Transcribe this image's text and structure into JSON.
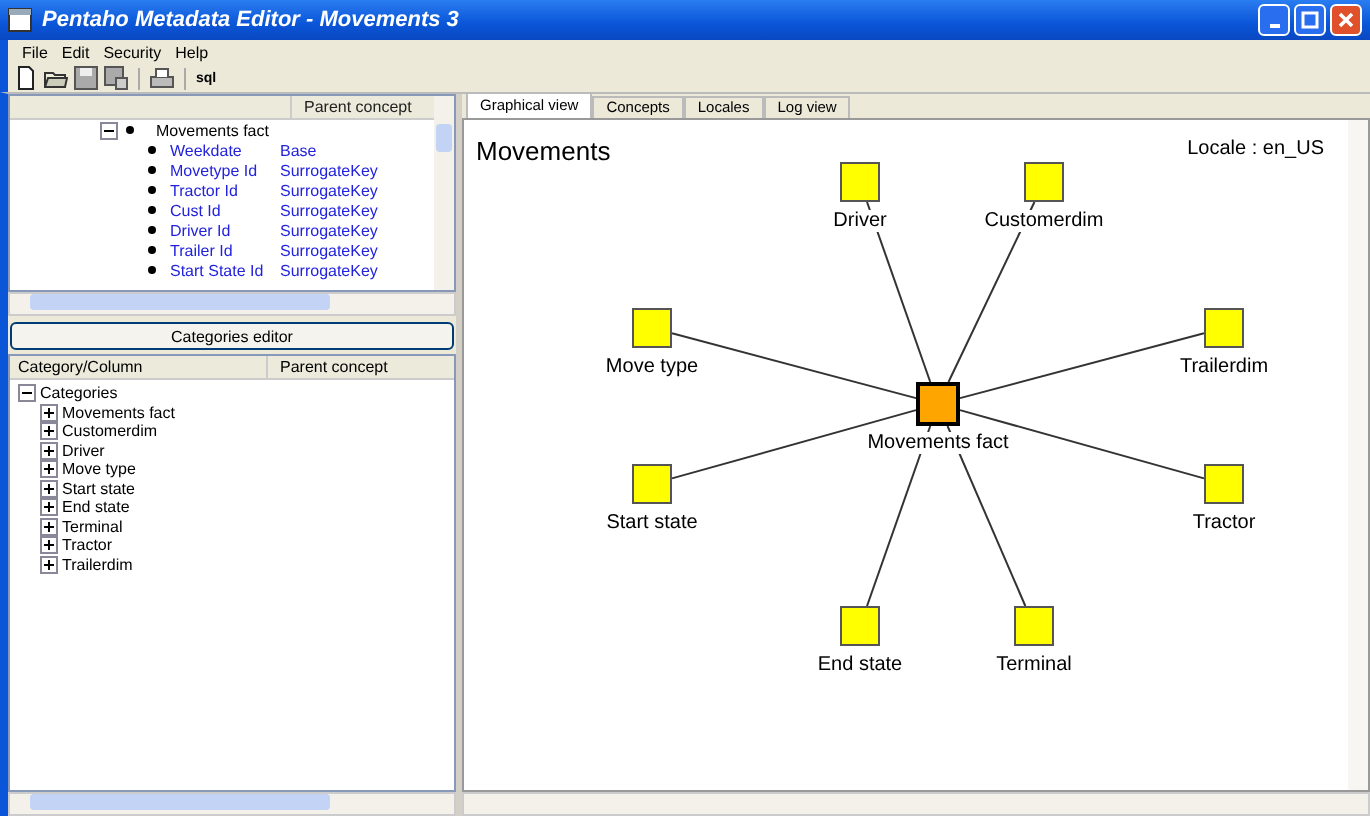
{
  "window": {
    "title": "Pentaho Metadata Editor - Movements 3"
  },
  "menu": [
    "File",
    "Edit",
    "Security",
    "Help"
  ],
  "toolbar": {
    "sql_label": "sql"
  },
  "model_tree": {
    "column": "Parent concept",
    "parent": {
      "label": "Movements fact",
      "expanded": true
    },
    "rows": [
      {
        "name": "Weekdate",
        "parent_concept": "Base"
      },
      {
        "name": "Movetype Id",
        "parent_concept": "SurrogateKey"
      },
      {
        "name": "Tractor Id",
        "parent_concept": "SurrogateKey"
      },
      {
        "name": "Cust Id",
        "parent_concept": "SurrogateKey"
      },
      {
        "name": "Driver Id",
        "parent_concept": "SurrogateKey"
      },
      {
        "name": "Trailer Id",
        "parent_concept": "SurrogateKey"
      },
      {
        "name": "Start State Id",
        "parent_concept": "SurrogateKey"
      }
    ]
  },
  "categories_button": "Categories editor",
  "categories_tree": {
    "columns": [
      "Category/Column",
      "Parent concept"
    ],
    "root": {
      "label": "Categories",
      "expanded": true
    },
    "children": [
      {
        "label": "Movements fact",
        "expanded": false
      },
      {
        "label": "Customerdim",
        "expanded": false
      },
      {
        "label": "Driver",
        "expanded": false
      },
      {
        "label": "Move type",
        "expanded": false
      },
      {
        "label": "Start state",
        "expanded": false
      },
      {
        "label": "End state",
        "expanded": false
      },
      {
        "label": "Terminal",
        "expanded": false
      },
      {
        "label": "Tractor",
        "expanded": false
      },
      {
        "label": "Trailerdim",
        "expanded": false
      }
    ]
  },
  "tabs": [
    {
      "label": "Graphical view",
      "selected": true
    },
    {
      "label": "Concepts",
      "selected": false
    },
    {
      "label": "Locales",
      "selected": false
    },
    {
      "label": "Log view",
      "selected": false
    }
  ],
  "graph": {
    "title": "Movements",
    "locale": "Locale : en_US",
    "center": {
      "label": "Movements fact"
    },
    "nodes": [
      {
        "label": "Driver"
      },
      {
        "label": "Customerdim"
      },
      {
        "label": "Move type"
      },
      {
        "label": "Trailerdim"
      },
      {
        "label": "Start state"
      },
      {
        "label": "Tractor"
      },
      {
        "label": "End state"
      },
      {
        "label": "Terminal"
      }
    ]
  }
}
